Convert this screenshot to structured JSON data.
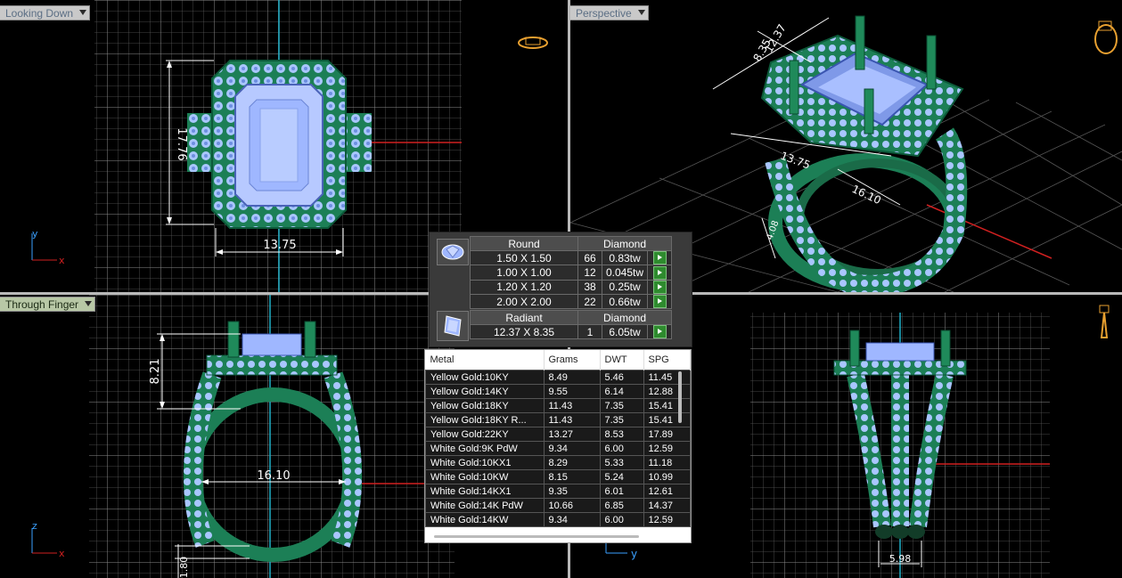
{
  "viewports": {
    "top_left": {
      "label": "Looking Down",
      "dim_vertical": "17.76",
      "dim_horizontal": "13.75",
      "axis_y": "y",
      "axis_x": "x"
    },
    "top_right": {
      "label": "Perspective",
      "dim_a": "8.35",
      "dim_b": "12.37",
      "dim_c": "13.75",
      "dim_d": "16.10",
      "dim_e": "4.08"
    },
    "bottom_left": {
      "label": "Through Finger",
      "dim_top": "8.21",
      "dim_width": "16.10",
      "dim_bottom": "1.80",
      "axis_z": "z",
      "axis_x": "x"
    },
    "bottom_right": {
      "label": "",
      "dim_width": "5.98",
      "axis_y": "y"
    }
  },
  "stones": {
    "groups": [
      {
        "shape": "Round",
        "material": "Diamond",
        "icon": "round-diamond-icon",
        "rows": [
          {
            "size": "1.50 X 1.50",
            "count": "66",
            "weight": "0.83tw"
          },
          {
            "size": "1.00 X 1.00",
            "count": "12",
            "weight": "0.045tw"
          },
          {
            "size": "1.20 X 1.20",
            "count": "38",
            "weight": "0.25tw"
          },
          {
            "size": "2.00 X 2.00",
            "count": "22",
            "weight": "0.66tw"
          }
        ]
      },
      {
        "shape": "Radiant",
        "material": "Diamond",
        "icon": "radiant-diamond-icon",
        "rows": [
          {
            "size": "12.37 X 8.35",
            "count": "1",
            "weight": "6.05tw"
          }
        ]
      }
    ]
  },
  "metals": {
    "headers": [
      "Metal",
      "Grams",
      "DWT",
      "SPG"
    ],
    "rows": [
      {
        "metal": "Yellow Gold:10KY",
        "grams": "8.49",
        "dwt": "5.46",
        "spg": "11.45"
      },
      {
        "metal": "Yellow Gold:14KY",
        "grams": "9.55",
        "dwt": "6.14",
        "spg": "12.88"
      },
      {
        "metal": "Yellow Gold:18KY",
        "grams": "11.43",
        "dwt": "7.35",
        "spg": "15.41"
      },
      {
        "metal": "Yellow Gold:18KY R...",
        "grams": "11.43",
        "dwt": "7.35",
        "spg": "15.41"
      },
      {
        "metal": "Yellow Gold:22KY",
        "grams": "13.27",
        "dwt": "8.53",
        "spg": "17.89"
      },
      {
        "metal": "White Gold:9K PdW",
        "grams": "9.34",
        "dwt": "6.00",
        "spg": "12.59"
      },
      {
        "metal": "White Gold:10KX1",
        "grams": "8.29",
        "dwt": "5.33",
        "spg": "11.18"
      },
      {
        "metal": "White Gold:10KW",
        "grams": "8.15",
        "dwt": "5.24",
        "spg": "10.99"
      },
      {
        "metal": "White Gold:14KX1",
        "grams": "9.35",
        "dwt": "6.01",
        "spg": "12.61"
      },
      {
        "metal": "White Gold:14K PdW",
        "grams": "10.66",
        "dwt": "6.85",
        "spg": "14.37"
      },
      {
        "metal": "White Gold:14KW",
        "grams": "9.34",
        "dwt": "6.00",
        "spg": "12.59"
      }
    ]
  },
  "colors": {
    "metal_green": "#1f8a5a",
    "gem_blue": "#8fb2ff",
    "grid": "#5a5a5a",
    "axis_red": "#d02020",
    "axis_cyan": "#1fb0c8"
  }
}
